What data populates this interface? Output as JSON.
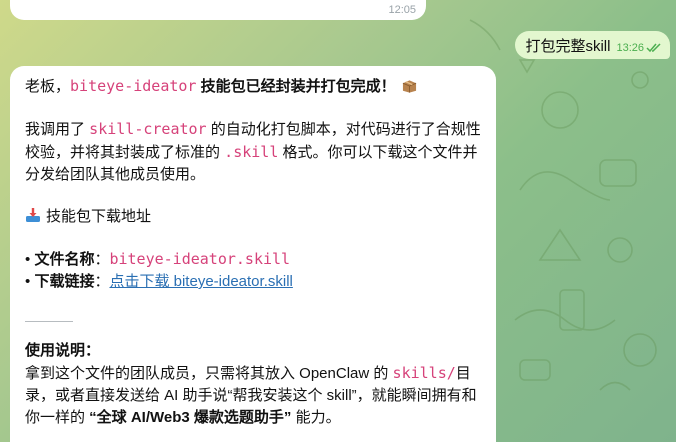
{
  "chat": {
    "previous_message": {
      "time": "12:05"
    },
    "outgoing": {
      "text": "打包完整skill",
      "time": "13:26"
    },
    "incoming": {
      "line1_pre": "老板，",
      "skill_name": "biteye-ideator",
      "line1_post": " 技能包已经封装并打包完成！",
      "box_icon": "package-icon",
      "para1_a": "我调用了 ",
      "creator_tool": "skill-creator",
      "para1_b": " 的自动化打包脚本，对代码进行了合规性校验，并将其封装成了标准的 ",
      "ext": ".skill",
      "para1_c": " 格式。你可以下载这个文件并分发给团队其他成员使用。",
      "download_heading": "技能包下载地址",
      "download_icon": "inbox-tray-icon",
      "file_label": "文件名称",
      "file_name": "biteye-ideator.skill",
      "link_label": "下载链接",
      "link_text": "点击下载 biteye-ideator.skill",
      "bullet": "•",
      "colon": "：",
      "usage_heading": "使用说明：",
      "usage_a": "拿到这个文件的团队成员，只需将其放入 OpenClaw 的 ",
      "skills_dir": "skills/",
      "usage_b": "目录，或者直接发送给 AI 助手说“帮我安装这个 skill”，就能瞬间拥有和你一样的 ",
      "usage_bold": "“全球 AI/Web3 爆款选题助手”",
      "usage_c": " 能力。"
    }
  },
  "colors": {
    "code": "#d6427a",
    "link": "#2a6fb3",
    "outgoing_bubble": "#e3f7cf",
    "read_check": "#4caf50"
  }
}
